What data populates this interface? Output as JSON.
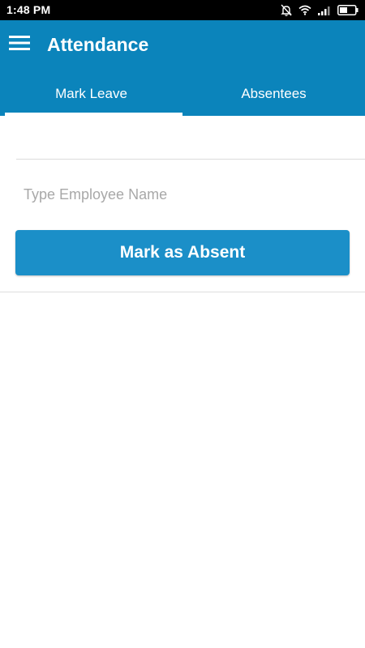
{
  "status_bar": {
    "time": "1:48 PM",
    "icons": [
      "notifications-off-icon",
      "wifi-icon",
      "signal-icon",
      "battery-icon"
    ]
  },
  "app_bar": {
    "title": "Attendance",
    "menu_icon": "hamburger-menu-icon",
    "tabs": [
      {
        "label": "Mark Leave",
        "selected": true
      },
      {
        "label": "Absentees",
        "selected": false
      }
    ]
  },
  "form": {
    "employee_name_value": "",
    "employee_name_placeholder": "Type Employee Name",
    "submit_label": "Mark as Absent"
  },
  "colors": {
    "app_bar": "#0b84bb",
    "button": "#1b8fc8",
    "status_bar": "#000000"
  }
}
